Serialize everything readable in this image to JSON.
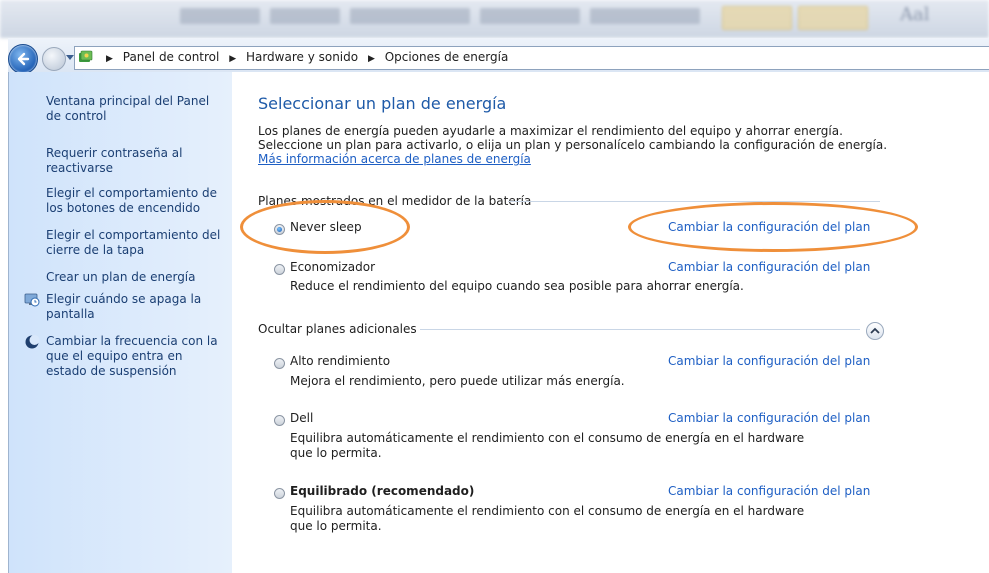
{
  "breadcrumb": {
    "items": [
      "Panel de control",
      "Hardware y sonido",
      "Opciones de energía"
    ]
  },
  "sidebar": {
    "items": [
      {
        "label": "Ventana principal del Panel de control",
        "icon": ""
      },
      {
        "label": "Requerir contraseña al reactivarse",
        "icon": ""
      },
      {
        "label": "Elegir el comportamiento de los botones de encendido",
        "icon": ""
      },
      {
        "label": "Elegir el comportamiento del cierre de la tapa",
        "icon": ""
      },
      {
        "label": "Crear un plan de energía",
        "icon": ""
      },
      {
        "label": "Elegir cuándo se apaga la pantalla",
        "icon": "monitor-clock-icon"
      },
      {
        "label": "Cambiar la frecuencia con la que el equipo entra en estado de suspensión",
        "icon": "moon-icon"
      }
    ]
  },
  "main": {
    "title": "Seleccionar un plan de energía",
    "intro": "Los planes de energía pueden ayudarle a maximizar el rendimiento del equipo y ahorrar energía. Seleccione un plan para activarlo, o elija un plan y personalícelo cambiando la configuración de energía.",
    "intro_link": "Más información acerca de planes de energía",
    "battery_group_label": "Planes mostrados en el medidor de la batería",
    "additional_group_label": "Ocultar planes adicionales",
    "change_link_label": "Cambiar la configuración del plan",
    "plans": [
      {
        "name": "Never sleep",
        "description": "",
        "selected": true
      },
      {
        "name": "Economizador",
        "description": "Reduce el rendimiento del equipo cuando sea posible para ahorrar energía.",
        "selected": false
      },
      {
        "name": "Alto rendimiento",
        "description": "Mejora el rendimiento, pero puede utilizar más energía.",
        "selected": false
      },
      {
        "name": "Dell",
        "description": "Equilibra automáticamente el rendimiento con el consumo de energía en el hardware que lo permita.",
        "selected": false
      },
      {
        "name": "Equilibrado (recomendado)",
        "description": "Equilibra automáticamente el rendimiento con el consumo de energía en el hardware que lo permita.",
        "selected": false
      }
    ]
  },
  "colors": {
    "highlight": "#ef8f3a",
    "link": "#1e5fc4",
    "title": "#1e5aa8",
    "sidebar_bg": "#d9e8fb"
  }
}
